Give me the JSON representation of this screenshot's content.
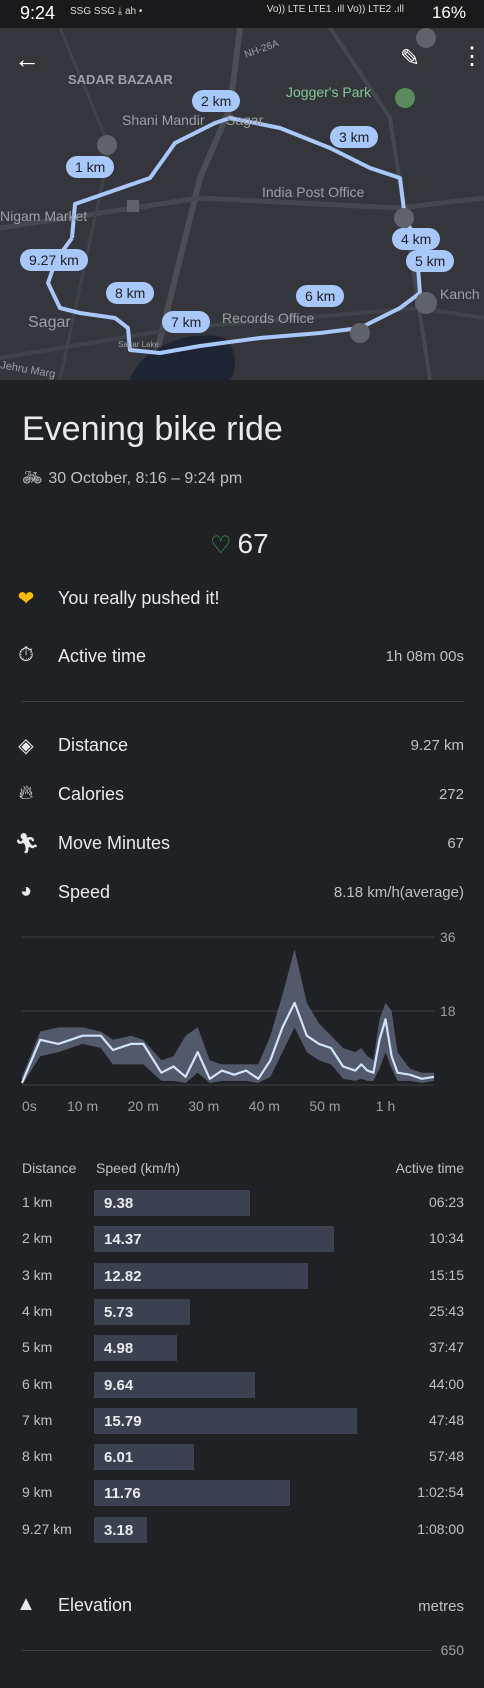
{
  "status_bar": {
    "time": "9:24",
    "mini_icons": "SSG SSG ⤓ ah •",
    "signal_text": "Vo)) LTE LTE1 .ıll Vo)) LTE2 .ıll",
    "battery": "16%"
  },
  "map": {
    "place_labels": [
      "SADAR BAZAAR",
      "Shani Mandir",
      "Sagar",
      "Jogger's Park",
      "India Post Office",
      "Nigam Market",
      "Sagar",
      "Kanch",
      "Records Office",
      "NH-26A",
      "Sagar Lake",
      "Jehru Marg"
    ],
    "km_markers": [
      "1 km",
      "2 km",
      "3 km",
      "4 km",
      "5 km",
      "6 km",
      "7 km",
      "8 km",
      "9.27 km"
    ],
    "back_icon": "arrow-left-icon",
    "edit_icon": "pencil-icon",
    "more_icon": "more-vert-icon"
  },
  "activity": {
    "title": "Evening bike ride",
    "date_time": "30 October, 8:16 – 9:24 pm",
    "heart_points": "67",
    "message": "You really pushed it!"
  },
  "stats": {
    "active_time_label": "Active time",
    "active_time_value": "1h 08m 00s",
    "distance_label": "Distance",
    "distance_value": "9.27 km",
    "calories_label": "Calories",
    "calories_value": "272",
    "move_minutes_label": "Move Minutes",
    "move_minutes_value": "67",
    "speed_label": "Speed",
    "speed_value": "8.18 km/h(average)"
  },
  "chart_data": {
    "type": "area",
    "title": "",
    "x_ticks": [
      "0s",
      "10 m",
      "20 m",
      "30 m",
      "40 m",
      "50 m",
      "1 h"
    ],
    "y_ticks": [
      "36",
      "18"
    ],
    "ylim": [
      0,
      36
    ],
    "xlim_minutes": [
      0,
      68
    ],
    "series": [
      {
        "x_minutes": [
          0,
          3,
          6,
          10,
          13,
          15,
          18,
          20,
          23,
          25,
          27,
          29,
          31,
          33,
          35,
          37,
          39,
          41,
          43,
          45,
          47,
          49,
          51,
          53,
          55,
          56,
          57,
          58,
          59,
          60,
          61,
          62,
          64,
          66,
          68
        ],
        "values": [
          0.5,
          11,
          10,
          12,
          12,
          8.5,
          10,
          10,
          3,
          4.5,
          2,
          8,
          1.5,
          3.5,
          2.5,
          3.5,
          1.5,
          6,
          14,
          20,
          12,
          10,
          9,
          4.5,
          3.5,
          5,
          3.5,
          3,
          11,
          16,
          7,
          3,
          2.5,
          1.5,
          2
        ]
      }
    ],
    "band_upper": [
      2,
      13,
      14,
      14,
      13,
      11,
      12,
      11,
      6,
      7,
      12,
      14,
      6,
      5,
      5,
      5,
      5,
      12,
      22,
      33,
      20,
      15,
      12,
      9,
      8,
      9,
      7,
      6,
      16,
      20,
      18,
      8,
      4,
      3,
      3
    ],
    "band_lower": [
      0,
      7,
      8,
      10,
      9,
      5,
      5,
      5,
      1,
      1,
      0.5,
      3,
      0.5,
      1,
      1,
      1,
      0.5,
      2,
      8,
      14,
      8,
      6,
      5,
      1.5,
      1,
      1.5,
      1,
      1,
      4,
      8,
      4,
      1,
      1,
      0.5,
      1
    ]
  },
  "splits": {
    "headers": {
      "distance": "Distance",
      "speed": "Speed (km/h)",
      "active_time": "Active time"
    },
    "max_speed_for_bars": 18,
    "rows": [
      {
        "km": "1 km",
        "speed": "9.38",
        "speed_num": 9.38,
        "time": "06:23"
      },
      {
        "km": "2 km",
        "speed": "14.37",
        "speed_num": 14.37,
        "time": "10:34"
      },
      {
        "km": "3 km",
        "speed": "12.82",
        "speed_num": 12.82,
        "time": "15:15"
      },
      {
        "km": "4 km",
        "speed": "5.73",
        "speed_num": 5.73,
        "time": "25:43"
      },
      {
        "km": "5 km",
        "speed": "4.98",
        "speed_num": 4.98,
        "time": "37:47"
      },
      {
        "km": "6 km",
        "speed": "9.64",
        "speed_num": 9.64,
        "time": "44:00"
      },
      {
        "km": "7 km",
        "speed": "15.79",
        "speed_num": 15.79,
        "time": "47:48"
      },
      {
        "km": "8 km",
        "speed": "6.01",
        "speed_num": 6.01,
        "time": "57:48"
      },
      {
        "km": "9 km",
        "speed": "11.76",
        "speed_num": 11.76,
        "time": "1:02:54"
      },
      {
        "km": "9.27 km",
        "speed": "3.18",
        "speed_num": 3.18,
        "time": "1:08:00"
      }
    ]
  },
  "elevation": {
    "label": "Elevation",
    "unit": "metres",
    "tick": "650"
  },
  "icons": {
    "bike": "bike-icon",
    "heart_points": "heart-points-icon",
    "fit_logo": "google-fit-heart-icon",
    "timer": "timer-icon",
    "distance": "distance-icon",
    "calories": "flame-icon",
    "move_minutes": "walking-icon",
    "speed": "speedometer-icon",
    "elevation": "mountain-icon"
  }
}
